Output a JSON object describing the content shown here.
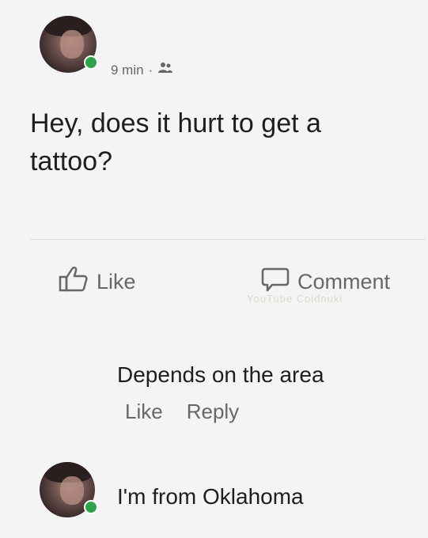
{
  "post": {
    "time": "9 min",
    "audience_icon": "friends-icon",
    "text": "Hey, does it hurt to get a tattoo?"
  },
  "actions": {
    "like_label": "Like",
    "comment_label": "Comment"
  },
  "watermark": "YouTube Coldnuki",
  "reply": {
    "text": "Depends on the area",
    "like_label": "Like",
    "reply_label": "Reply"
  },
  "comment": {
    "text": "I'm from Oklahoma"
  },
  "colors": {
    "online": "#31a24c",
    "secondary_text": "#65676b",
    "primary_text": "#1c1e21"
  }
}
